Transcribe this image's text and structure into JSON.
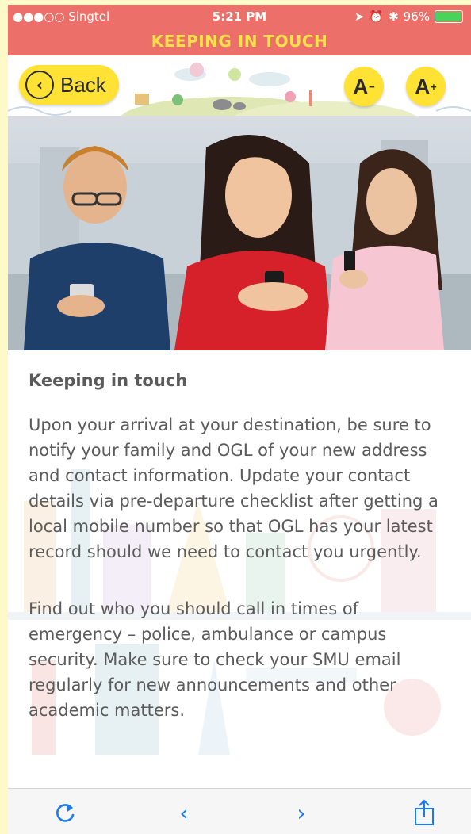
{
  "status_bar": {
    "carrier": "●●●○○ Singtel",
    "time": "5:21 PM",
    "battery": "96%",
    "battery_level": 0.96
  },
  "header": {
    "title": "KEEPING IN TOUCH",
    "back_label": "Back",
    "font_decrease_label": "A",
    "font_decrease_sup": "−",
    "font_increase_label": "A",
    "font_increase_sup": "+"
  },
  "article": {
    "heading": "Keeping in touch",
    "paragraph_1": "Upon your arrival at your destination, be sure to notify your family and OGL of your new address and contact information. Update your contact details via pre-departure checklist after getting a local mobile number so that OGL has your latest record should we need to contact you urgently.",
    "paragraph_2": "Find out who you should call in times of emergency – police, ambulance or campus security. Make sure to check your SMU email regularly for new announcements and other academic matters."
  },
  "toolbar": {
    "reload_icon": "reload-icon",
    "prev_label": "‹",
    "next_label": "›",
    "share_icon": "share-icon"
  },
  "colors": {
    "title_bar": "#ec6f6a",
    "title_text": "#ffe14a",
    "button_yellow": "#ffe234",
    "link_blue": "#1a7cf0",
    "body_text": "#5b5b5b"
  }
}
